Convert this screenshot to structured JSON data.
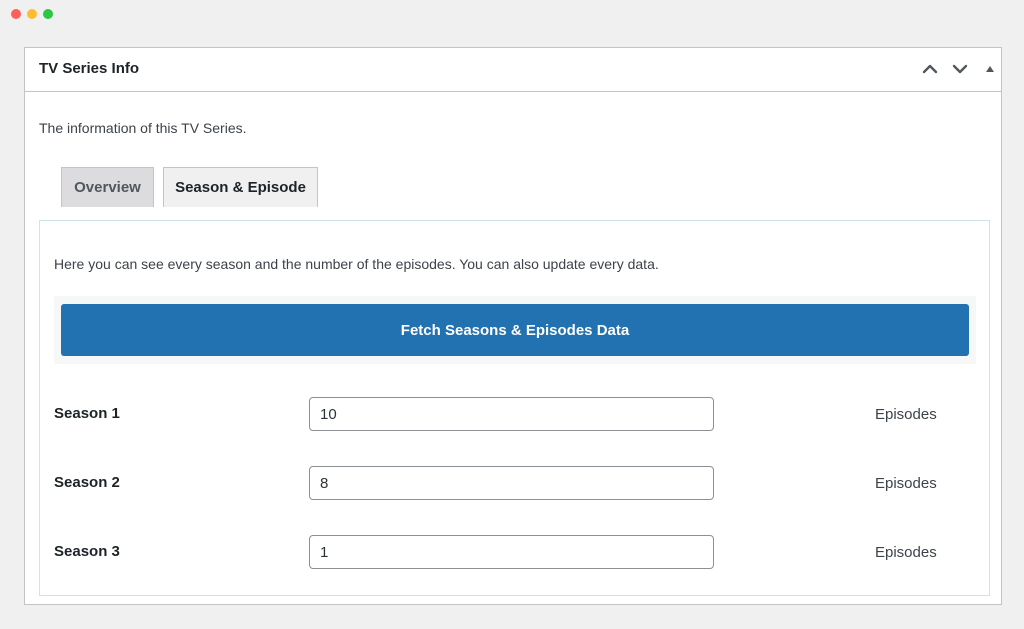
{
  "window": {
    "controls": [
      "close",
      "minimize",
      "maximize"
    ]
  },
  "metabox": {
    "title": "TV Series Info",
    "header_icons": [
      "chevron-up-icon",
      "chevron-down-icon",
      "triangle-up-icon"
    ],
    "intro": "The information of this TV Series."
  },
  "tabs": [
    {
      "label": "Overview",
      "active": false
    },
    {
      "label": "Season & Episode",
      "active": true
    }
  ],
  "panel": {
    "description": "Here you can see every season and the number of the episodes. You can also update every data.",
    "fetch_button_label": "Fetch Seasons & Episodes Data",
    "seasons": [
      {
        "label": "Season 1",
        "value": "10",
        "unit": "Episodes"
      },
      {
        "label": "Season 2",
        "value": "8",
        "unit": "Episodes"
      },
      {
        "label": "Season 3",
        "value": "1",
        "unit": "Episodes"
      }
    ]
  },
  "colors": {
    "primary_button": "#2271b1",
    "background": "#f0f0f1",
    "panel_border": "#cfe3ea"
  }
}
